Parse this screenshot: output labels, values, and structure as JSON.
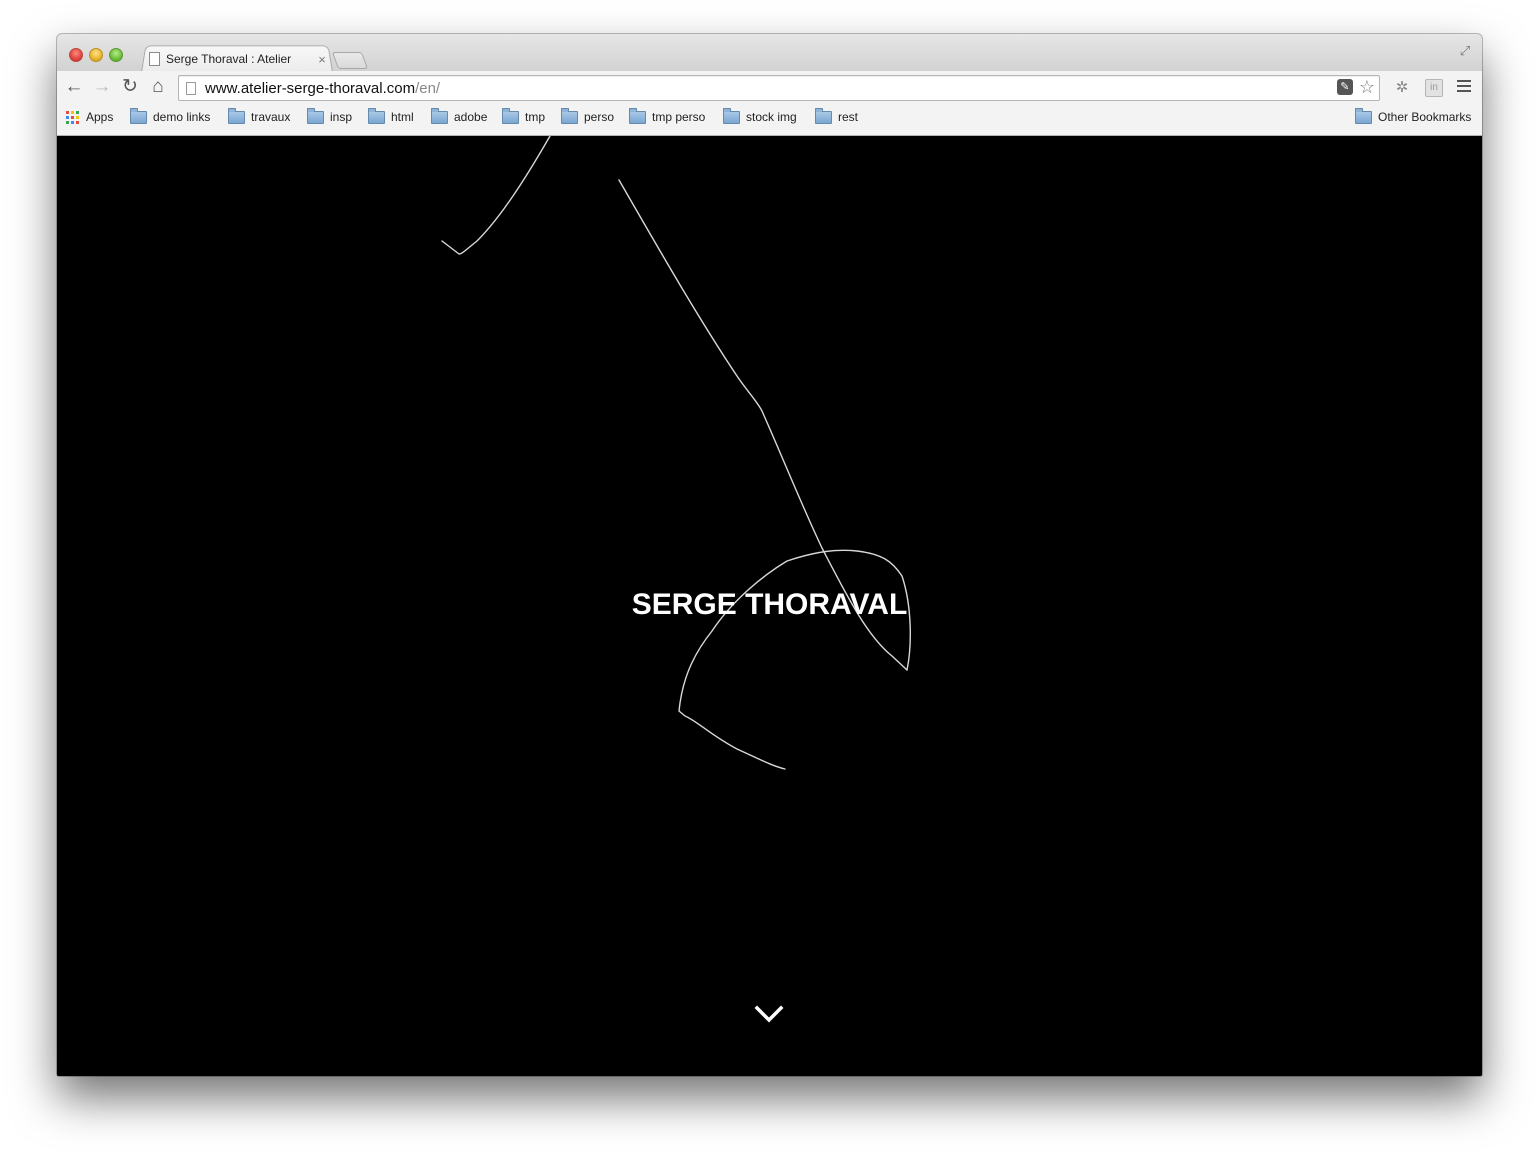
{
  "browser": {
    "tab": {
      "title": "Serge Thoraval : Atelier",
      "close": "×"
    },
    "nav": {
      "back": "←",
      "forward": "→",
      "reload": "↻",
      "home": "⌂"
    },
    "url": {
      "domain": "www.atelier-serge-thoraval.com",
      "path": "/en/"
    },
    "bookmarks": {
      "apps_label": "Apps",
      "items": [
        "demo links",
        "travaux",
        "insp",
        "html",
        "adobe",
        "tmp",
        "perso",
        "tmp perso",
        "stock img",
        "rest"
      ],
      "other": "Other Bookmarks"
    },
    "icons": [
      "close-icon",
      "page-icon",
      "back-icon",
      "forward-icon",
      "reload-icon",
      "home-icon",
      "star-icon",
      "menu-icon",
      "folder-icon",
      "apps-icon",
      "fullscreen-icon",
      "extension-icon",
      "linkedin-icon"
    ]
  },
  "page": {
    "title": "SERGE THORAVAL",
    "background": "#000000",
    "text_color": "#ffffff",
    "scroll_indicator": "chevron-down-icon"
  }
}
